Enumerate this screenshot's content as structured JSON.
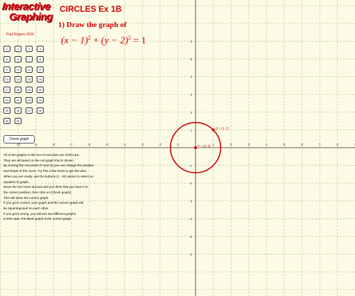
{
  "app": {
    "title": "CIRCLES Ex 1B"
  },
  "logo": {
    "line1": "Interactive",
    "line2": "Graphing"
  },
  "author": "Paul Rogers 2016",
  "question": {
    "label": "1) Draw the graph of",
    "equation_left": "(x − 1)",
    "plus": " + ",
    "equation_right": "(y − 2)",
    "squared": "2",
    "equals": " = 1"
  },
  "exercise_buttons": [
    "1",
    "2",
    "3",
    "4",
    "5",
    "6",
    "7",
    "8",
    "9",
    "10",
    "11",
    "12",
    "13",
    "14",
    "15",
    "16",
    "17",
    "18",
    "19",
    "20",
    "21",
    "22",
    "23",
    "24",
    "25",
    "26",
    "27",
    "28",
    "29",
    "30"
  ],
  "check_button": "Check graph",
  "instructions": [
    "All of the graphs in this set of exercises are CIRCLES.",
    "They are all based on the red graph that is shown.",
    "By moving the red points (P and Q) you can change the position",
    "and shape of the curve. Try this a few times to get the idea.",
    "When you are ready, use the buttons (1 - 30) above to select an",
    "equation to graph.",
    "Move the red curve around until you think that you have it in",
    "the correct position; then click on [Check graph].",
    "This will show the correct graph.",
    "If you got it correct, your graph and the correct graph will",
    "be superimposed on each other.",
    "If you got it wrong, you will see two different graphs.",
    "In this case, the black graph is the correct graph"
  ],
  "points": {
    "P": {
      "label": "P = (0, 0)",
      "x": 0,
      "y": 0
    },
    "Q": {
      "label": "Q = (1, 1)",
      "x": 1,
      "y": 1
    }
  },
  "circle": {
    "center": [
      0,
      0
    ],
    "radius": 1.414
  },
  "axes": {
    "x_ticks": [
      -10,
      -9,
      -8,
      -7,
      -6,
      -5,
      -4,
      -3,
      -2,
      -1,
      1,
      2,
      3,
      4,
      5,
      6,
      7,
      8,
      9
    ],
    "y_ticks": [
      6,
      5,
      4,
      3,
      2,
      1,
      -1,
      -2,
      -3,
      -4,
      -5,
      -6
    ]
  },
  "colors": {
    "accent": "#d00000",
    "grid": "#c8c8a0",
    "background": "#fbfbe6"
  }
}
